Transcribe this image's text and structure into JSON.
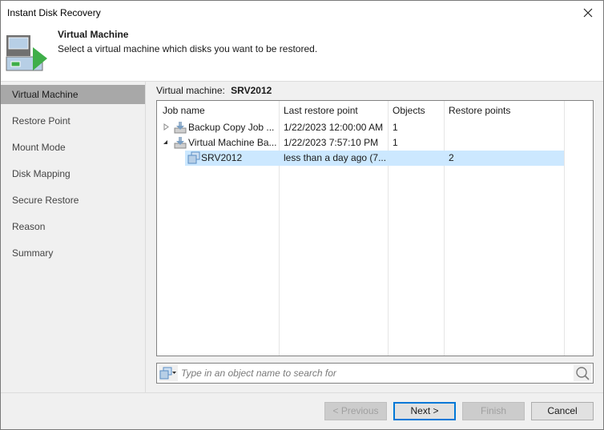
{
  "window": {
    "title": "Instant Disk Recovery",
    "close_icon": "close-icon"
  },
  "header": {
    "title": "Virtual Machine",
    "subtitle": "Select a virtual machine which disks you want to be restored.",
    "icon": "vm-restore-wizard-icon"
  },
  "sidebar": {
    "items": [
      {
        "label": "Virtual Machine",
        "active": true
      },
      {
        "label": "Restore Point",
        "active": false
      },
      {
        "label": "Mount Mode",
        "active": false
      },
      {
        "label": "Disk Mapping",
        "active": false
      },
      {
        "label": "Secure Restore",
        "active": false
      },
      {
        "label": "Reason",
        "active": false
      },
      {
        "label": "Summary",
        "active": false
      }
    ]
  },
  "vm_selection": {
    "label": "Virtual machine:",
    "value": "SRV2012"
  },
  "grid": {
    "columns": [
      "Job name",
      "Last restore point",
      "Objects",
      "Restore points"
    ],
    "rows": [
      {
        "expander": "collapsed",
        "icon": "backup-job-icon",
        "name": "Backup Copy Job ...",
        "last_restore_point": "1/22/2023 12:00:00 AM",
        "objects": "1",
        "restore_points": "",
        "selected": false
      },
      {
        "expander": "expanded",
        "icon": "backup-job-icon",
        "name": "Virtual Machine Ba...",
        "last_restore_point": "1/22/2023 7:57:10 PM",
        "objects": "1",
        "restore_points": "",
        "selected": false
      },
      {
        "expander": "none",
        "icon": "vm-icon",
        "name": "SRV2012",
        "last_restore_point": "less than a day ago (7...",
        "objects": "",
        "restore_points": "2",
        "selected": true
      }
    ]
  },
  "search": {
    "placeholder": "Type in an object name to search for",
    "value": ""
  },
  "buttons": {
    "previous": "< Previous",
    "next": "Next >",
    "finish": "Finish",
    "cancel": "Cancel"
  }
}
